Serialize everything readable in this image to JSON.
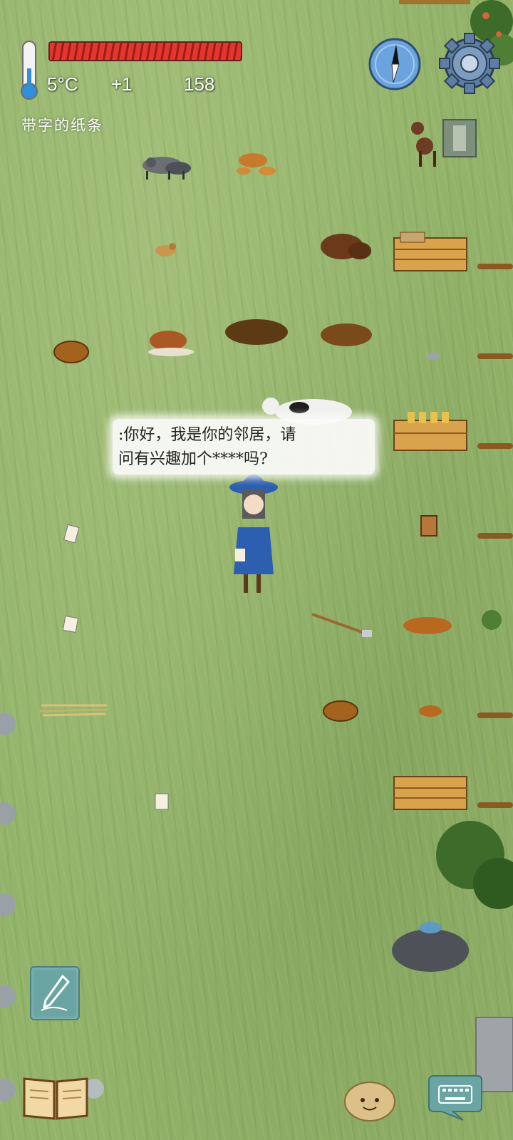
{
  "hud": {
    "temperature": "5°C",
    "temperature_delta": "+1",
    "count": "158",
    "health_fraction": 1.0,
    "held_item": "带字的纸条",
    "thermometer_icon": "thermometer-icon",
    "compass_icon": "compass-icon",
    "settings_icon": "gear-icon"
  },
  "speech": {
    "line1": ":你好，我是你的邻居，请",
    "line2": "问有兴趣加个****吗?"
  },
  "controls": {
    "pen_icon": "pen-icon",
    "book_icon": "book-icon",
    "emote_icon": "smiley-potato-icon",
    "keyboard_icon": "keyboard-icon"
  },
  "colors": {
    "grass": "#93b36a",
    "health": "#e2372e",
    "button_teal": "#6aa5a4",
    "hat_blue": "#2d5fb0"
  }
}
